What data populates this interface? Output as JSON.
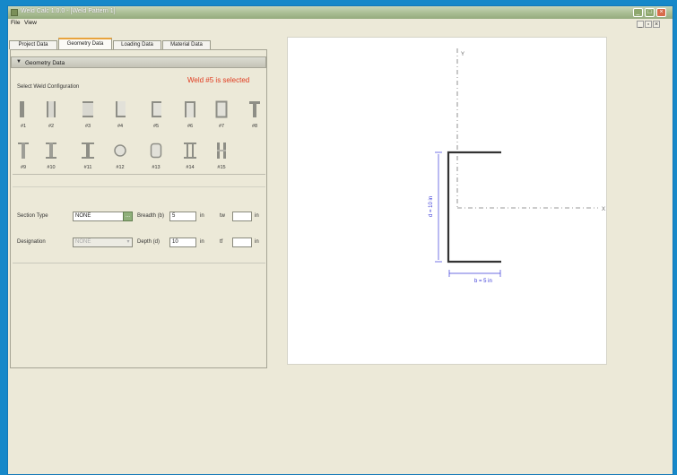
{
  "window": {
    "title": "Weld Calc 1.0.0 - [Weld Pattern 1]",
    "icon": "app-icon",
    "controls": [
      "minimize-icon",
      "maximize-icon",
      "close-icon"
    ]
  },
  "menu": {
    "items": [
      "File",
      "View"
    ]
  },
  "mdi_controls": {
    "min": "_",
    "restore": "▫",
    "close": "×"
  },
  "tabs": [
    {
      "label": "Project Data",
      "selected": false
    },
    {
      "label": "Geometry Data",
      "selected": true
    },
    {
      "label": "Loading Data",
      "selected": false
    },
    {
      "label": "Material Data",
      "selected": false
    }
  ],
  "geometry": {
    "section_title": "Geometry Data",
    "collapse_arrow": "▼",
    "selected_message": "Weld #5 is selected",
    "config_label": "Select Weld Configuration",
    "configs": [
      {
        "label": "#1",
        "shape": "single-bar"
      },
      {
        "label": "#2",
        "shape": "two-vertical"
      },
      {
        "label": "#3",
        "shape": "two-horizontal"
      },
      {
        "label": "#4",
        "shape": "angle"
      },
      {
        "label": "#5",
        "shape": "channel"
      },
      {
        "label": "#6",
        "shape": "channel-h"
      },
      {
        "label": "#7",
        "shape": "box"
      },
      {
        "label": "#8",
        "shape": "t-shape"
      },
      {
        "label": "#9",
        "shape": "t-inverted"
      },
      {
        "label": "#10",
        "shape": "i-beam"
      },
      {
        "label": "#11",
        "shape": "i-beam-wide"
      },
      {
        "label": "#12",
        "shape": "circle"
      },
      {
        "label": "#13",
        "shape": "rounded-box"
      },
      {
        "label": "#14",
        "shape": "i-double"
      },
      {
        "label": "#15",
        "shape": "double-vertical"
      }
    ],
    "form": {
      "section_type_label": "Section Type",
      "section_type_value": "NONE",
      "section_type_button": "...",
      "designation_label": "Designation",
      "designation_value": "NONE",
      "designation_arrow": "▾",
      "breadth_label": "Breadth (b)",
      "breadth_value": "5",
      "breadth_unit": "in",
      "depth_label": "Depth (d)",
      "depth_value": "10",
      "depth_unit": "in",
      "tw_label": "tw",
      "tw_value": "",
      "tw_unit": "in",
      "tf_label": "tf",
      "tf_value": "",
      "tf_unit": "in"
    }
  },
  "canvas": {
    "axis_y_label": "Y",
    "axis_x_label": "X",
    "depth_dim_label": "d = 10 in",
    "breadth_dim_label": "b = 5 in",
    "line_color": "#222222",
    "axis_color": "#666666",
    "dim_color": "#3b3bd8"
  },
  "colors": {
    "desktop": "#1688c9",
    "panel": "#ece9d8",
    "warning": "#e03a1e",
    "tab_accent": "#e8a33c"
  }
}
